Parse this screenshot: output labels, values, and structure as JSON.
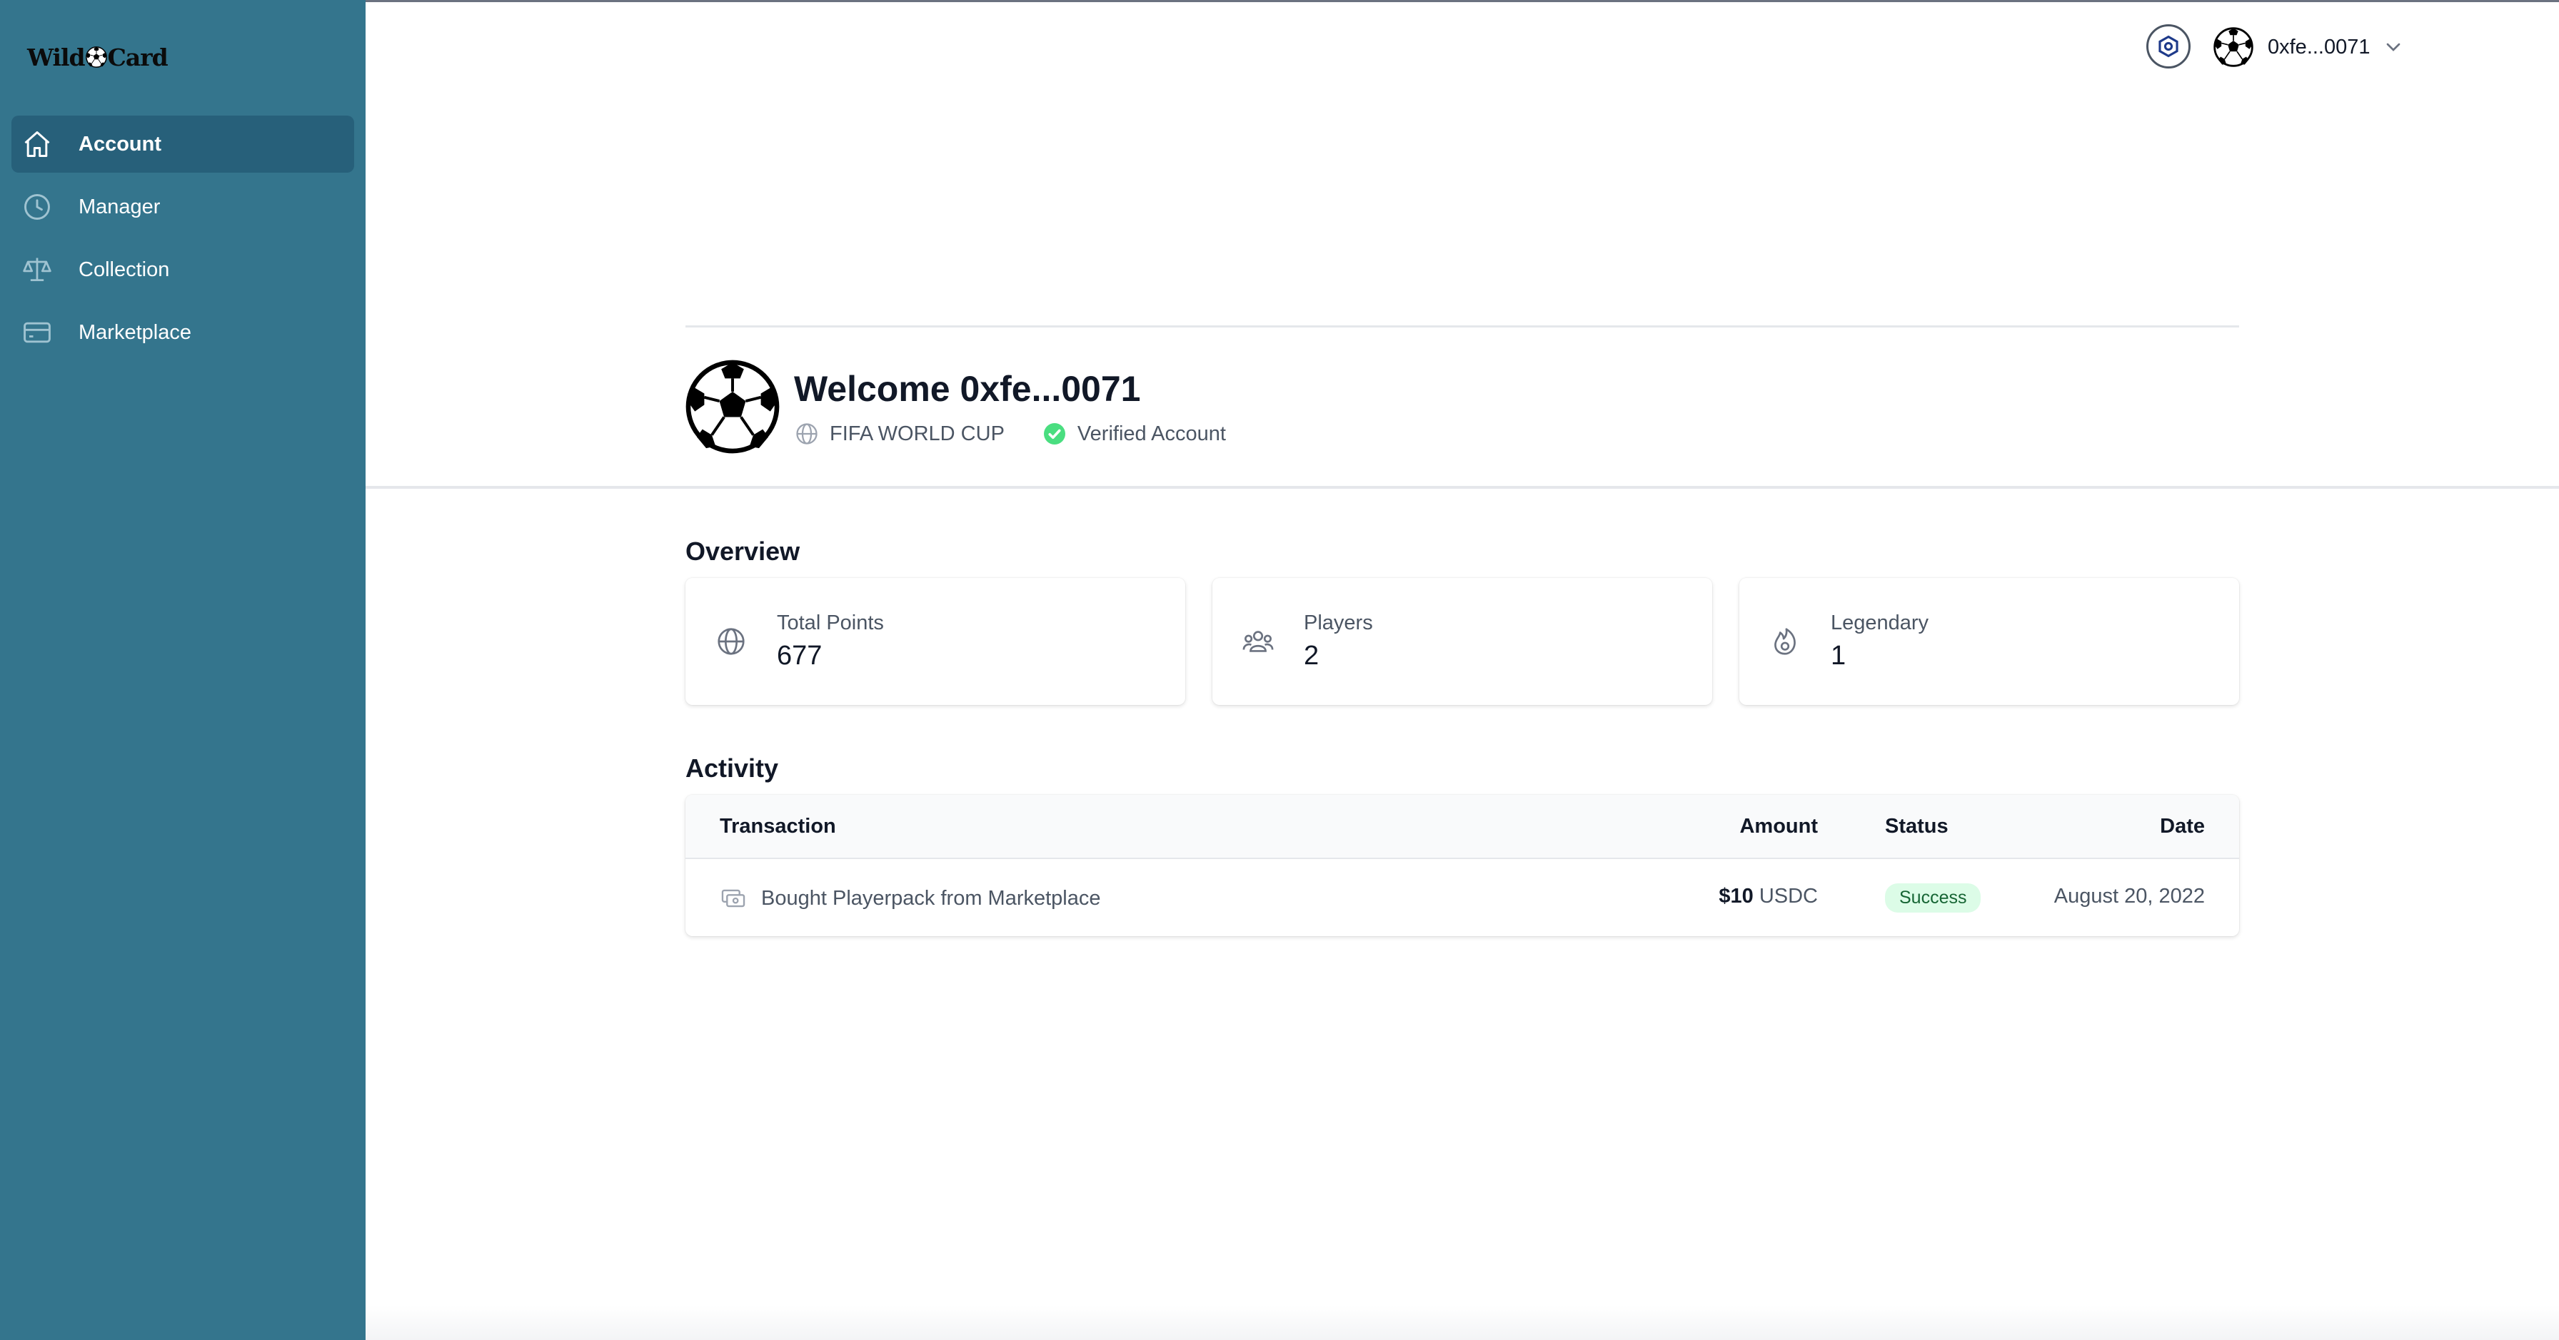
{
  "app": {
    "logo_text_left": "Wild",
    "logo_text_right": "Card"
  },
  "sidebar": {
    "items": [
      {
        "label": "Account",
        "icon": "home-icon",
        "active": true
      },
      {
        "label": "Manager",
        "icon": "clock-icon",
        "active": false
      },
      {
        "label": "Collection",
        "icon": "scale-icon",
        "active": false
      },
      {
        "label": "Marketplace",
        "icon": "credit-card-icon",
        "active": false
      }
    ]
  },
  "header": {
    "settings_icon": "hexagon-settings-icon",
    "username": "0xfe...0071"
  },
  "profile": {
    "welcome": "Welcome 0xfe...0071",
    "league": "FIFA WORLD CUP",
    "verified": "Verified Account"
  },
  "overview": {
    "title": "Overview",
    "cards": [
      {
        "label": "Total Points",
        "value": "677",
        "icon": "globe-icon"
      },
      {
        "label": "Players",
        "value": "2",
        "icon": "users-icon"
      },
      {
        "label": "Legendary",
        "value": "1",
        "icon": "fire-icon"
      }
    ]
  },
  "activity": {
    "title": "Activity",
    "columns": {
      "transaction": "Transaction",
      "amount": "Amount",
      "status": "Status",
      "date": "Date"
    },
    "rows": [
      {
        "transaction": "Bought Playerpack from Marketplace",
        "amount_value": "$10",
        "amount_currency": "USDC",
        "status": "Success",
        "date": "August 20, 2022"
      }
    ]
  },
  "colors": {
    "sidebar": "#34758d",
    "sidebar_active": "#27607a",
    "success_bg": "#dcfce7",
    "success_text": "#166534",
    "verified_green": "#22c55e"
  }
}
